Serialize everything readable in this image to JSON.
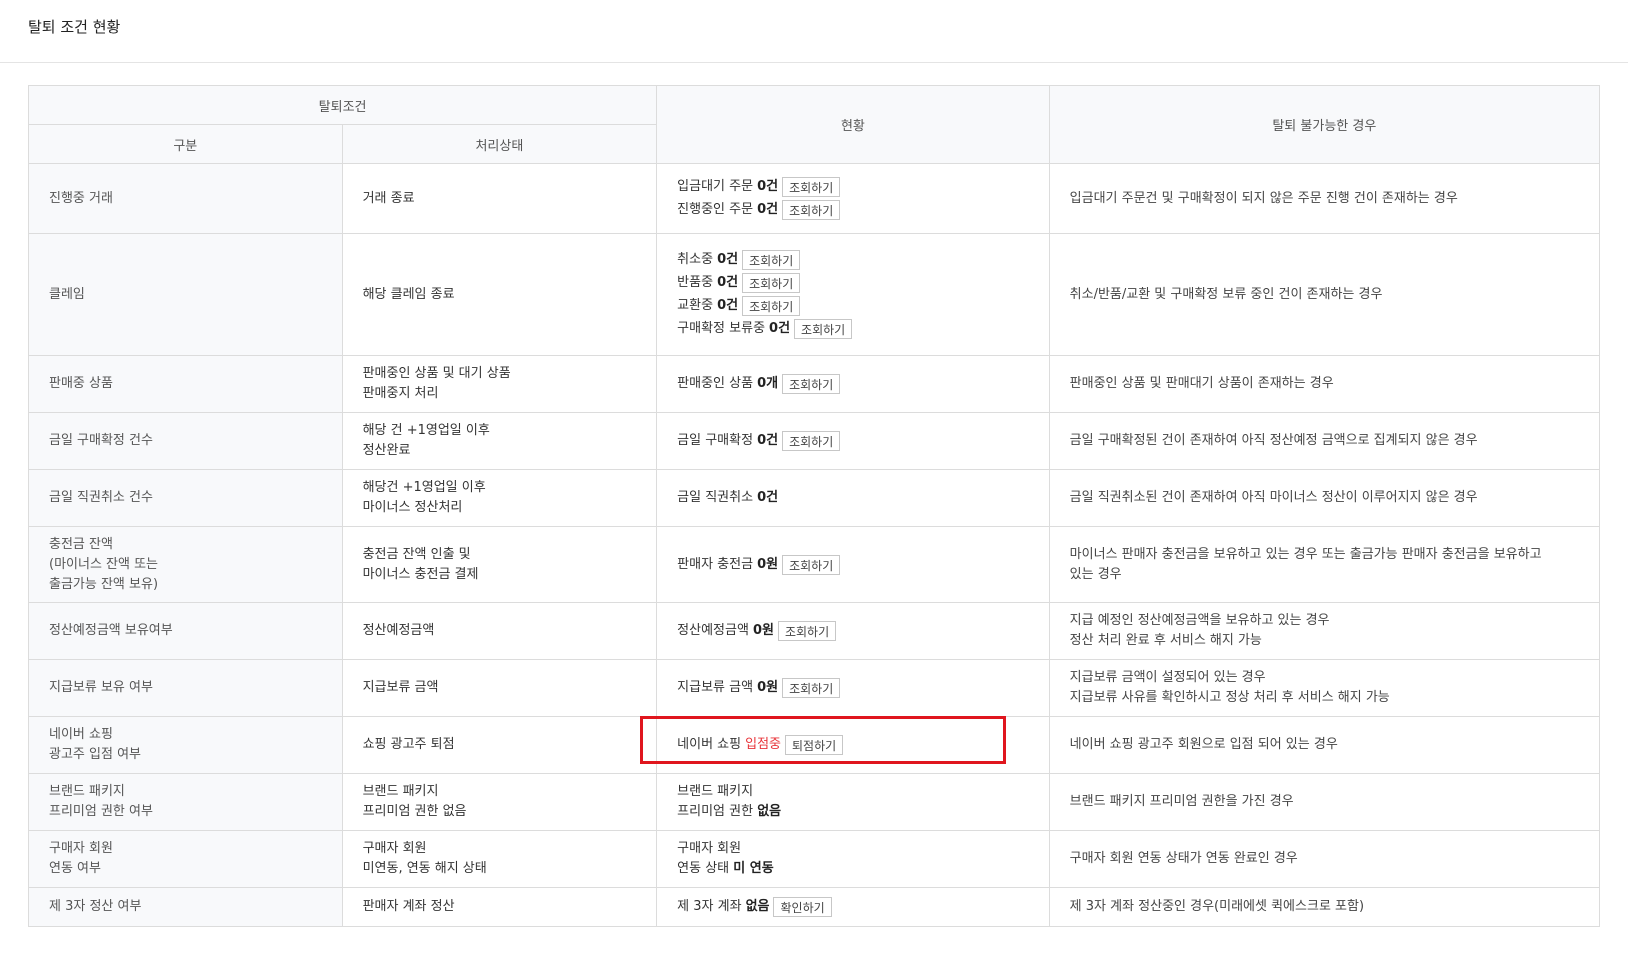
{
  "page": {
    "title": "탈퇴 조건 현황"
  },
  "headers": {
    "group": "탈퇴조건",
    "category": "구분",
    "process": "처리상태",
    "status": "현황",
    "reason": "탈퇴 불가능한 경우"
  },
  "rows": [
    {
      "category": [
        "진행중 거래"
      ],
      "process": [
        "거래 종료"
      ],
      "status": [
        {
          "text": "입금대기 주문",
          "value": "0건",
          "button": "조회하기"
        },
        {
          "text": "진행중인 주문",
          "value": "0건",
          "button": "조회하기"
        }
      ],
      "reason": [
        "입금대기 주문건 및 구매확정이 되지 않은 주문 진행 건이 존재하는 경우"
      ]
    },
    {
      "category": [
        "클레임"
      ],
      "process": [
        "해당 클레임 종료"
      ],
      "status": [
        {
          "text": "취소중",
          "value": "0건",
          "button": "조회하기"
        },
        {
          "text": "반품중",
          "value": "0건",
          "button": "조회하기"
        },
        {
          "text": "교환중",
          "value": "0건",
          "button": "조회하기"
        },
        {
          "text": "구매확정 보류중",
          "value": "0건",
          "button": "조회하기"
        }
      ],
      "reason": [
        "취소/반품/교환 및 구매확정 보류 중인 건이 존재하는 경우"
      ]
    },
    {
      "category": [
        "판매중 상품"
      ],
      "process": [
        "판매중인 상품 및 대기 상품",
        "판매중지 처리"
      ],
      "status": [
        {
          "text": "판매중인 상품",
          "value": "0개",
          "button": "조회하기"
        }
      ],
      "reason": [
        "판매중인 상품 및 판매대기 상품이 존재하는 경우"
      ]
    },
    {
      "category": [
        "금일 구매확정 건수"
      ],
      "process": [
        "해당 건 +1영업일 이후",
        "정산완료"
      ],
      "status": [
        {
          "text": "금일 구매확정",
          "value": "0건",
          "button": "조회하기"
        }
      ],
      "reason": [
        "금일 구매확정된 건이 존재하여 아직 정산예정 금액으로 집계되지 않은 경우"
      ]
    },
    {
      "category": [
        "금일 직권취소 건수"
      ],
      "process": [
        "해당건 +1영업일 이후",
        "마이너스 정산처리"
      ],
      "status": [
        {
          "text": "금일 직권취소",
          "value": "0건"
        }
      ],
      "reason": [
        "금일 직권취소된 건이 존재하여 아직 마이너스 정산이 이루어지지 않은 경우"
      ]
    },
    {
      "category": [
        "충전금 잔액",
        "(마이너스 잔액 또는",
        "출금가능 잔액 보유)"
      ],
      "process": [
        "충전금 잔액 인출 및",
        "마이너스 충전금 결제"
      ],
      "status": [
        {
          "text": "판매자 충전금",
          "value": "0원",
          "button": "조회하기"
        }
      ],
      "reason": [
        "마이너스 판매자 충전금을 보유하고 있는 경우 또는 출금가능 판매자 충전금을 보유하고",
        "있는 경우"
      ]
    },
    {
      "category": [
        "정산예정금액 보유여부"
      ],
      "process": [
        "정산예정금액"
      ],
      "status": [
        {
          "text": "정산예정금액",
          "value": "0원",
          "button": "조회하기"
        }
      ],
      "reason": [
        "지급 예정인 정산예정금액을 보유하고 있는 경우",
        "정산 처리 완료 후 서비스 해지 가능"
      ]
    },
    {
      "category": [
        "지급보류 보유 여부"
      ],
      "process": [
        "지급보류 금액"
      ],
      "status": [
        {
          "text": "지급보류 금액",
          "value": "0원",
          "button": "조회하기"
        }
      ],
      "reason": [
        "지급보류 금액이 설정되어 있는 경우",
        "지급보류 사유를 확인하시고 정상 처리 후 서비스 해지 가능"
      ]
    },
    {
      "category": [
        "네이버 쇼핑",
        "광고주 입점 여부"
      ],
      "process": [
        "쇼핑 광고주 퇴점"
      ],
      "status": [
        {
          "text": "네이버 쇼핑",
          "value": "입점중",
          "value_color": "red",
          "button": "퇴점하기"
        }
      ],
      "reason": [
        "네이버 쇼핑 광고주 회원으로 입점 되어 있는 경우"
      ]
    },
    {
      "category": [
        "브랜드 패키지",
        "프리미엄 권한 여부"
      ],
      "process": [
        "브랜드 패키지",
        "프리미엄 권한 없음"
      ],
      "status_plain": [
        {
          "text": "브랜드 패키지"
        },
        {
          "text": "프리미엄 권한",
          "value": "없음"
        }
      ],
      "reason": [
        "브랜드 패키지 프리미엄 권한을 가진 경우"
      ]
    },
    {
      "category": [
        "구매자 회원",
        "연동 여부"
      ],
      "process": [
        "구매자 회원",
        "미연동, 연동 해지 상태"
      ],
      "status_plain": [
        {
          "text": "구매자 회원"
        },
        {
          "text": "연동 상태",
          "value": "미 연동"
        }
      ],
      "reason": [
        "구매자 회원 연동 상태가 연동 완료인 경우"
      ]
    },
    {
      "category": [
        "제 3자 정산 여부"
      ],
      "process": [
        "판매자 계좌 정산"
      ],
      "status": [
        {
          "text": "제 3자 계좌",
          "value": "없음",
          "button": "확인하기"
        }
      ],
      "reason": [
        "제 3자 계좌 정산중인 경우(미래에셋 퀵에스크로 포함)"
      ]
    }
  ],
  "colors": {
    "highlight": "#e0161e",
    "status_red": "#e8343a",
    "header_bg": "#f8f9fb",
    "border": "#dcdcdc"
  }
}
